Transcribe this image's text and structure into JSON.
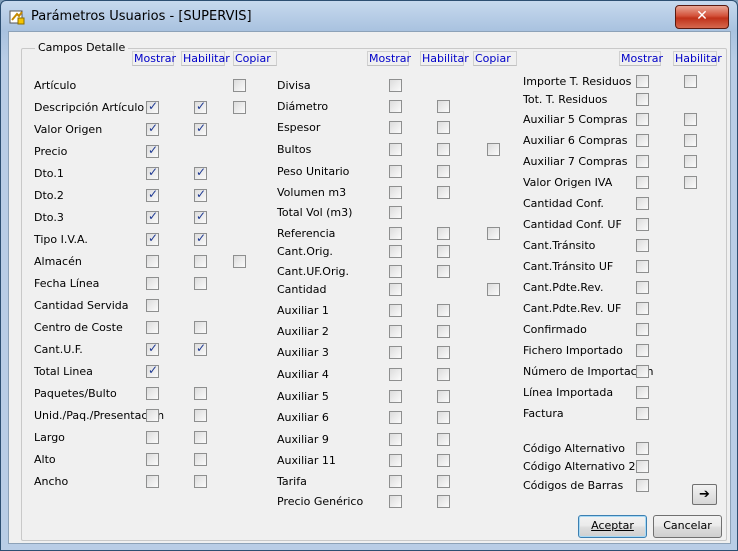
{
  "window": {
    "title": "Parámetros Usuarios - [SUPERVIS]",
    "close_label": "✕"
  },
  "group": {
    "label": "Campos Detalle"
  },
  "headers": {
    "mostrar": "Mostrar",
    "habilitar": "Habilitar",
    "copiar": "Copiar"
  },
  "columns": [
    {
      "rows": [
        {
          "label": "Artículo",
          "mostrar": null,
          "habilitar": null,
          "copiar": false
        },
        {
          "label": "Descripción Artículo",
          "mostrar": true,
          "habilitar": true,
          "copiar": false
        },
        {
          "label": "Valor Origen",
          "mostrar": true,
          "habilitar": true,
          "copiar": null
        },
        {
          "label": "Precio",
          "mostrar": true,
          "habilitar": null,
          "copiar": null
        },
        {
          "label": "Dto.1",
          "mostrar": true,
          "habilitar": true,
          "copiar": null
        },
        {
          "label": "Dto.2",
          "mostrar": true,
          "habilitar": true,
          "copiar": null
        },
        {
          "label": "Dto.3",
          "mostrar": true,
          "habilitar": true,
          "copiar": null
        },
        {
          "label": "Tipo I.V.A.",
          "mostrar": true,
          "habilitar": true,
          "copiar": null
        },
        {
          "label": "Almacén",
          "mostrar": false,
          "habilitar": false,
          "copiar": false
        },
        {
          "label": "Fecha Línea",
          "mostrar": false,
          "habilitar": false,
          "copiar": null
        },
        {
          "label": "Cantidad Servida",
          "mostrar": false,
          "habilitar": null,
          "copiar": null
        },
        {
          "label": "Centro de Coste",
          "mostrar": false,
          "habilitar": false,
          "copiar": null
        },
        {
          "label": "Cant.U.F.",
          "mostrar": true,
          "habilitar": true,
          "copiar": null
        },
        {
          "label": "Total Linea",
          "mostrar": true,
          "habilitar": null,
          "copiar": null
        },
        {
          "label": "Paquetes/Bulto",
          "mostrar": false,
          "habilitar": false,
          "copiar": null
        },
        {
          "label": "Unid./Paq./Presentación",
          "mostrar": false,
          "habilitar": false,
          "copiar": null
        },
        {
          "label": "Largo",
          "mostrar": false,
          "habilitar": false,
          "copiar": null
        },
        {
          "label": "Alto",
          "mostrar": false,
          "habilitar": false,
          "copiar": null
        },
        {
          "label": "Ancho",
          "mostrar": false,
          "habilitar": false,
          "copiar": null
        }
      ]
    },
    {
      "rows": [
        {
          "label": "Divisa",
          "mostrar": false,
          "habilitar": null,
          "copiar": null
        },
        {
          "label": "Diámetro",
          "mostrar": false,
          "habilitar": false,
          "copiar": null
        },
        {
          "label": "Espesor",
          "mostrar": false,
          "habilitar": false,
          "copiar": null
        },
        {
          "label": "Bultos",
          "mostrar": false,
          "habilitar": false,
          "copiar": false
        },
        {
          "label": "Peso Unitario",
          "mostrar": false,
          "habilitar": false,
          "copiar": null
        },
        {
          "label": "Volumen m3",
          "mostrar": false,
          "habilitar": false,
          "copiar": null
        },
        {
          "label": "Total Vol (m3)",
          "mostrar": false,
          "habilitar": null,
          "copiar": null
        },
        {
          "label": "Referencia",
          "mostrar": false,
          "habilitar": false,
          "copiar": false
        },
        {
          "label": "Cant.Orig.",
          "mostrar": false,
          "habilitar": false,
          "copiar": null
        },
        {
          "label": "Cant.UF.Orig.",
          "mostrar": false,
          "habilitar": false,
          "copiar": null
        },
        {
          "label": "Cantidad",
          "mostrar": false,
          "habilitar": null,
          "copiar": false
        },
        {
          "label": "Auxiliar 1",
          "mostrar": false,
          "habilitar": false,
          "copiar": null
        },
        {
          "label": "Auxiliar 2",
          "mostrar": false,
          "habilitar": false,
          "copiar": null
        },
        {
          "label": "Auxiliar 3",
          "mostrar": false,
          "habilitar": false,
          "copiar": null
        },
        {
          "label": "Auxiliar 4",
          "mostrar": false,
          "habilitar": false,
          "copiar": null
        },
        {
          "label": "Auxiliar 5",
          "mostrar": false,
          "habilitar": false,
          "copiar": null
        },
        {
          "label": "Auxiliar 6",
          "mostrar": false,
          "habilitar": false,
          "copiar": null
        },
        {
          "label": "Auxiliar 9",
          "mostrar": false,
          "habilitar": false,
          "copiar": null
        },
        {
          "label": "Auxiliar 11",
          "mostrar": false,
          "habilitar": false,
          "copiar": null
        },
        {
          "label": "Tarifa",
          "mostrar": false,
          "habilitar": false,
          "copiar": null
        },
        {
          "label": "Precio Genérico",
          "mostrar": false,
          "habilitar": false,
          "copiar": null
        }
      ]
    },
    {
      "rows": [
        {
          "label": "Importe T. Residuos",
          "mostrar": false,
          "habilitar": false
        },
        {
          "label": "Tot. T. Residuos",
          "mostrar": false,
          "habilitar": null
        },
        {
          "label": "Auxiliar 5 Compras",
          "mostrar": false,
          "habilitar": false
        },
        {
          "label": "Auxiliar 6 Compras",
          "mostrar": false,
          "habilitar": false
        },
        {
          "label": "Auxiliar 7 Compras",
          "mostrar": false,
          "habilitar": false
        },
        {
          "label": "Valor Origen IVA",
          "mostrar": false,
          "habilitar": false
        },
        {
          "label": "Cantidad Conf.",
          "mostrar": false,
          "habilitar": null
        },
        {
          "label": "Cantidad Conf. UF",
          "mostrar": false,
          "habilitar": null
        },
        {
          "label": "Cant.Tránsito",
          "mostrar": false,
          "habilitar": null
        },
        {
          "label": "Cant.Tránsito UF",
          "mostrar": false,
          "habilitar": null
        },
        {
          "label": "Cant.Pdte.Rev.",
          "mostrar": false,
          "habilitar": null
        },
        {
          "label": "Cant.Pdte.Rev. UF",
          "mostrar": false,
          "habilitar": null
        },
        {
          "label": "Confirmado",
          "mostrar": false,
          "habilitar": null
        },
        {
          "label": "Fichero Importado",
          "mostrar": false,
          "habilitar": null
        },
        {
          "label": "Número de Importación",
          "mostrar": false,
          "habilitar": null
        },
        {
          "label": "Línea Importada",
          "mostrar": false,
          "habilitar": null
        },
        {
          "label": "Factura",
          "mostrar": false,
          "habilitar": null
        },
        {
          "label": "Código Alternativo",
          "mostrar": false,
          "habilitar": null
        },
        {
          "label": "Código Alternativo 2",
          "mostrar": false,
          "habilitar": null
        },
        {
          "label": "Códigos de Barras",
          "mostrar": false,
          "habilitar": null
        }
      ]
    }
  ],
  "buttons": {
    "accept": "Aceptar",
    "cancel": "Cancelar",
    "next_icon": "arrow-right-icon"
  }
}
